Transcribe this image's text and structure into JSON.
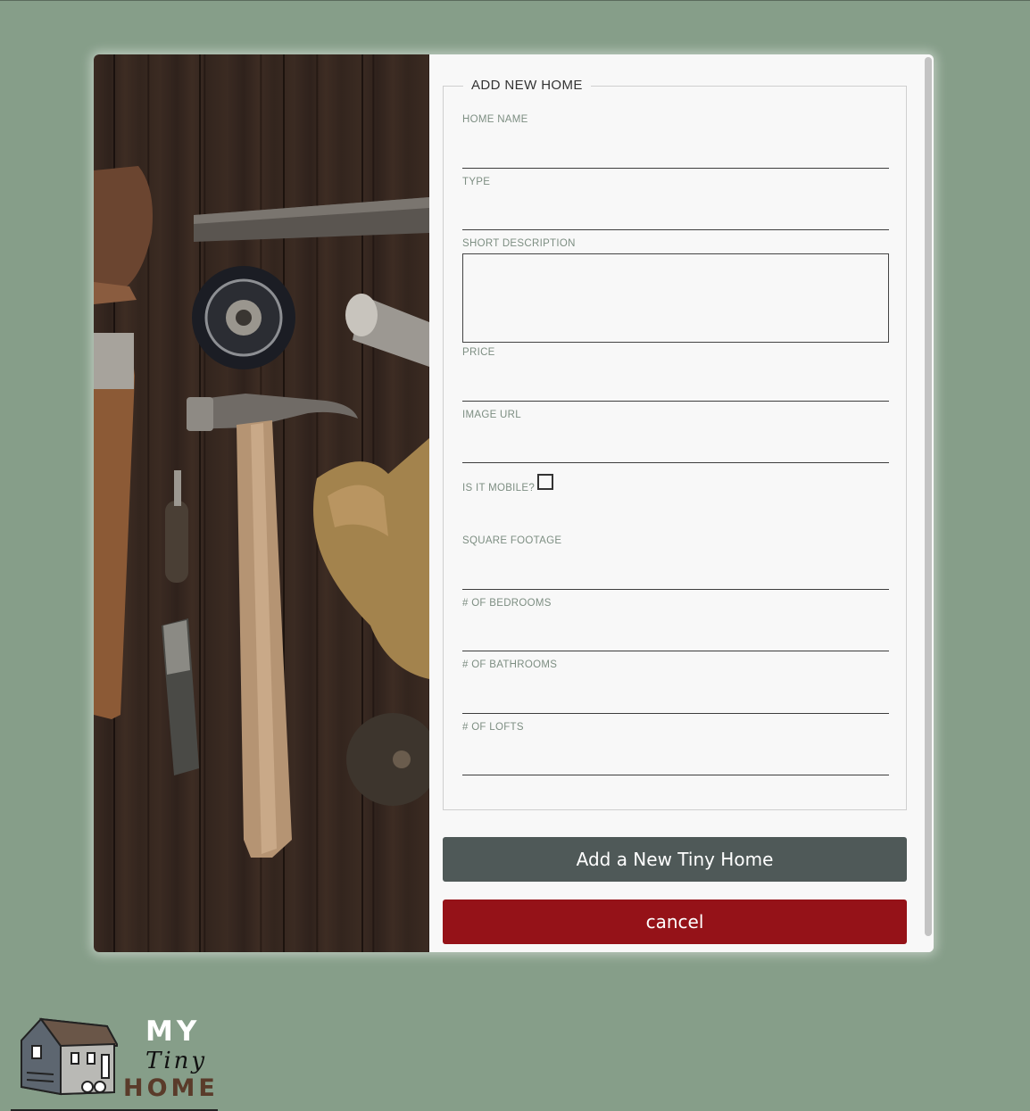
{
  "form": {
    "legend": "ADD NEW HOME",
    "fields": {
      "home_name": "HOME NAME",
      "type": "TYPE",
      "short_description": "SHORT DESCRIPTION",
      "price": "PRICE",
      "image_url": "IMAGE URL",
      "is_mobile": "IS IT MOBILE?",
      "square_footage": "SQUARE FOOTAGE",
      "bedrooms": "# OF BEDROOMS",
      "bathrooms": "# OF BATHROOMS",
      "lofts": "# OF LOFTS"
    },
    "values": {
      "home_name": "",
      "type": "",
      "short_description": "",
      "price": "",
      "image_url": "",
      "is_mobile": false,
      "square_footage": "",
      "bedrooms": "",
      "bathrooms": "",
      "lofts": ""
    }
  },
  "buttons": {
    "add": "Add a New Tiny Home",
    "cancel": "cancel"
  },
  "logo": {
    "line1": "MY",
    "line2": "Tiny",
    "line3": "HOME"
  },
  "colors": {
    "background": "#869e89",
    "add_button": "#4f5958",
    "cancel_button": "#951218",
    "label": "#7d8e82"
  },
  "icons": {
    "photo": "tools-on-wood-photo",
    "logo": "tiny-house-icon"
  }
}
